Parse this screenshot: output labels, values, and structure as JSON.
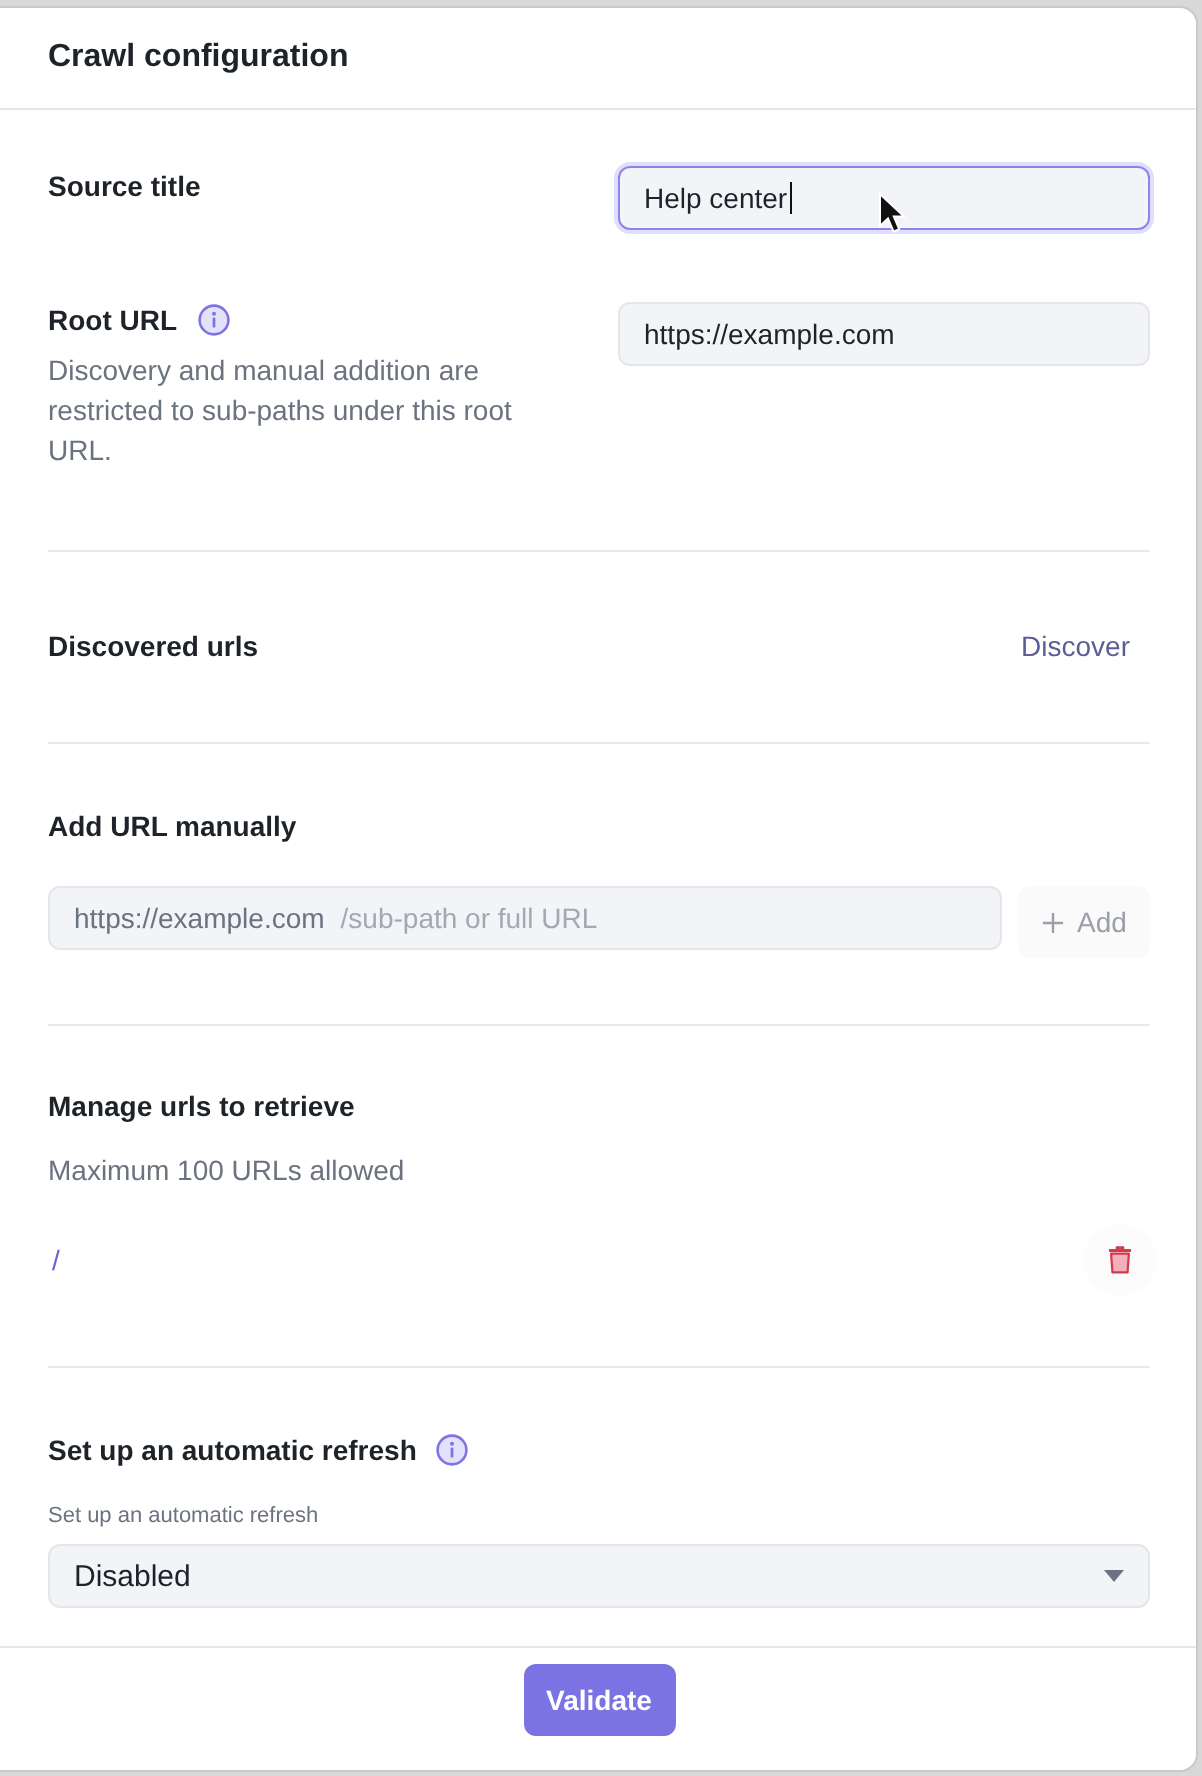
{
  "dialog": {
    "title": "Crawl configuration"
  },
  "source_title": {
    "label": "Source title",
    "value": "Help center",
    "focused": true
  },
  "root_url": {
    "label": "Root URL",
    "description": "Discovery and manual addition are restricted to sub-paths under this root URL.",
    "value": "https://example.com"
  },
  "discovered_urls": {
    "label": "Discovered urls",
    "action": "Discover"
  },
  "add_url": {
    "label": "Add URL manually",
    "prefix": "https://example.com",
    "placeholder": "/sub-path or full URL",
    "button": {
      "label": "Add",
      "disabled": true
    }
  },
  "manage_urls": {
    "label": "Manage urls to retrieve",
    "note": "Maximum 100 URLs allowed",
    "urls": [
      {
        "path": "/"
      }
    ]
  },
  "refresh": {
    "label": "Set up an automatic refresh",
    "field_label": "Set up an automatic refresh",
    "value": "Disabled"
  },
  "footer": {
    "button": "Validate"
  }
}
